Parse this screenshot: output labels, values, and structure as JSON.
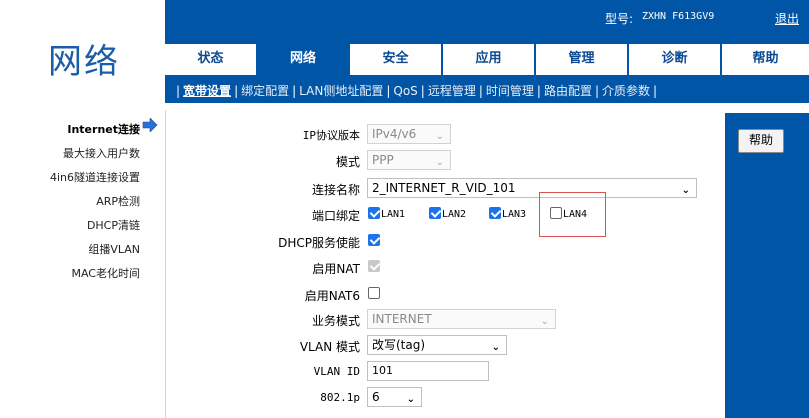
{
  "brand": {
    "title": "网络"
  },
  "header": {
    "model_label": "型号:",
    "model_value": "ZXHN F613GV9",
    "logout": "退出"
  },
  "tabs": [
    "状态",
    "网络",
    "安全",
    "应用",
    "管理",
    "诊断",
    "帮助"
  ],
  "active_tab": "网络",
  "subnav": [
    "宽带设置",
    "绑定配置",
    "LAN侧地址配置",
    "QoS",
    "远程管理",
    "时间管理",
    "路由配置",
    "介质参数"
  ],
  "active_subnav": "宽带设置",
  "sidebar": [
    "Internet连接",
    "最大接入用户数",
    "4in6隧道连接设置",
    "ARP检测",
    "DHCP清链",
    "组播VLAN",
    "MAC老化时间"
  ],
  "active_sidebar": "Internet连接",
  "form": {
    "ip_version": {
      "label": "IP协议版本",
      "value": "IPv4/v6"
    },
    "mode": {
      "label": "模式",
      "value": "PPP"
    },
    "conn_name": {
      "label": "连接名称",
      "value": "2_INTERNET_R_VID_101"
    },
    "port_bind": {
      "label": "端口绑定",
      "lans": [
        {
          "name": "LAN1",
          "checked": true
        },
        {
          "name": "LAN2",
          "checked": true
        },
        {
          "name": "LAN3",
          "checked": true
        },
        {
          "name": "LAN4",
          "checked": false
        }
      ]
    },
    "dhcp": {
      "label": "DHCP服务使能",
      "checked": true
    },
    "nat": {
      "label": "启用NAT",
      "checked": true,
      "disabled": true
    },
    "nat6": {
      "label": "启用NAT6",
      "checked": false
    },
    "service_mode": {
      "label": "业务模式",
      "value": "INTERNET"
    },
    "vlan_mode": {
      "label": "VLAN 模式",
      "value": "改写(tag)"
    },
    "vlan_id": {
      "label": "VLAN ID",
      "value": "101"
    },
    "dot1p": {
      "label": "802.1p",
      "value": "6"
    }
  },
  "help_button": "帮助",
  "colors": {
    "primary": "#0055a6",
    "tab_text": "#0b4a92",
    "highlight_box": "#d9534f",
    "checkbox": "#1a73e8"
  }
}
